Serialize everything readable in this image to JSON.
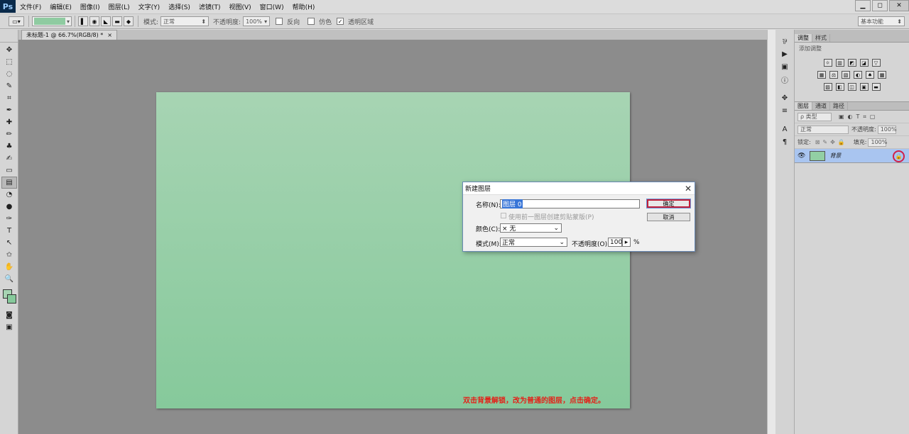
{
  "app": {
    "logo": "Ps"
  },
  "menu": [
    "文件(F)",
    "编辑(E)",
    "图像(I)",
    "图层(L)",
    "文字(Y)",
    "选择(S)",
    "滤镜(T)",
    "视图(V)",
    "窗口(W)",
    "帮助(H)"
  ],
  "window_buttons": [
    "▁",
    "◻",
    "✕"
  ],
  "options_bar": {
    "mode_label": "模式:",
    "mode_value": "正常",
    "opacity_label": "不透明度:",
    "opacity_value": "100%",
    "reverse_label": "反向",
    "dither_label": "仿色",
    "transparency_label": "透明区域",
    "workspace": "基本功能",
    "gradient_color": "#8fcba1"
  },
  "document": {
    "tab_title": "未标题-1 @ 66.7%(RGB/8) *",
    "tab_close": "×",
    "caption": "双击背景解锁，改为普通的图层，点击确定。",
    "canvas_colors": [
      "#a7d4b3",
      "#86c99b"
    ]
  },
  "tools": [
    "move-tool-icon",
    "marquee-tool-icon",
    "lasso-tool-icon",
    "quick-select-tool-icon",
    "crop-tool-icon",
    "eyedropper-tool-icon",
    "healing-brush-icon",
    "brush-tool-icon",
    "stamp-tool-icon",
    "history-brush-icon",
    "eraser-tool-icon",
    "gradient-tool-icon",
    "blur-tool-icon",
    "dodge-tool-icon",
    "pen-tool-icon",
    "type-tool-icon",
    "path-select-icon",
    "shape-tool-icon",
    "hand-tool-icon",
    "zoom-tool-icon"
  ],
  "tool_glyphs": [
    "✥",
    "⬚",
    "◌",
    "✎",
    "⌗",
    "✒",
    "✚",
    "✏",
    "♣",
    "✍",
    "▭",
    "▤",
    "◔",
    "●",
    "✑",
    "T",
    "↖",
    "✩",
    "✋",
    "🔍"
  ],
  "adjust_panel": {
    "tabs": [
      "调整",
      "样式"
    ],
    "title": "添加调整",
    "row1": [
      "☼",
      "▥",
      "◩",
      "◪",
      "▽"
    ],
    "row2": [
      "▦",
      "⚖",
      "▧",
      "◐",
      "♠",
      "▩"
    ],
    "row3": [
      "▨",
      "◧",
      "◫",
      "▣",
      "▬"
    ]
  },
  "layers_panel": {
    "tabs": [
      "图层",
      "通道",
      "路径"
    ],
    "filter_label": "ρ 类型",
    "blend_mode": "正常",
    "opacity_label": "不透明度:",
    "opacity_value": "100%",
    "lock_label": "锁定:",
    "fill_label": "填充:",
    "fill_value": "100%",
    "layer_name": "背景",
    "lock_icon": "🔒",
    "eye_icon": "👁"
  },
  "dialog": {
    "title": "新建图层",
    "close": "✕",
    "name_label": "名称(N):",
    "name_value": "图层 0",
    "clip_label": "使用前一图层创建剪贴蒙版(P)",
    "color_label": "颜色(C):",
    "color_value": "× 无",
    "mode_label": "模式(M):",
    "mode_value": "正常",
    "opacity_label": "不透明度(O):",
    "opacity_value": "100",
    "percent": "%",
    "ok_label": "确定",
    "cancel_label": "取消",
    "arrow": "▸",
    "dropdown": "⌄"
  }
}
